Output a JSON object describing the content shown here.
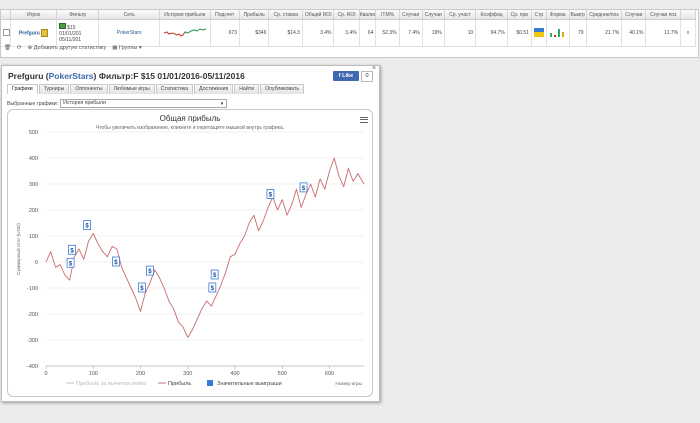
{
  "table": {
    "headers": [
      "",
      "Игрок",
      "Фильтр",
      "Сеть",
      "История прибыли",
      "Подсчет",
      "Прибыль",
      "Ср. ставка",
      "Общий ROI",
      "Ср. ROI",
      "Квалиф",
      "ITM%",
      "Случаи",
      "Случаи",
      "Ср. участ",
      "Коэффиц",
      "Ср. при",
      "Стр",
      "Форма",
      "Выигр",
      "Средние/поз",
      "Случаи",
      "Случаи поз",
      ""
    ],
    "row": {
      "player": "Prefguru",
      "filter_line1": "$15",
      "filter_line2": "01/01/201",
      "filter_line3": "05/11/201",
      "network": "PokerStars",
      "count": "673",
      "profit": "$346",
      "avg_stake": "$14.3",
      "total_roi": "3.4%",
      "avg_roi": "3.4%",
      "qualif": "64",
      "itm": "52.3%",
      "cases1": "7.4%",
      "cases2": "19%",
      "avg_part": "10",
      "coef": "94.7%",
      "avg_prize": "$0.51",
      "wins": "79",
      "avg_pos": "21.7%",
      "cases3": "40.1%",
      "cases_pos": "11.7%",
      "extra": "x"
    },
    "footer_stats": "Добавить другую статистику",
    "footer_groups": "Группы"
  },
  "panel": {
    "title_player": "Prefguru",
    "title_site": "PokerStars",
    "title_filter": "Фильтр:F $15 01/01/2016-05/11/2016",
    "fb_like": "Like",
    "fb_count": "0",
    "close": "×",
    "tabs": [
      "Графики",
      "Турниры",
      "Оппоненты",
      "Любимые игры",
      "Статистика",
      "Достижения",
      "Найти",
      "Опубликовать"
    ],
    "select_label": "Выбранные графики:",
    "select_value": "История прибыли"
  },
  "chart_data": {
    "type": "line",
    "title": "Общая прибыль",
    "subtitle": "Чтобы увеличить изображение, кликните и перетащите мышкой внутрь графика.",
    "ylabel": "Суммарный итог (USD)",
    "xlabel": "Номер игры",
    "xlim": [
      0,
      673
    ],
    "ylim": [
      -400,
      500
    ],
    "xticks": [
      0,
      100,
      200,
      300,
      400,
      500,
      600
    ],
    "yticks": [
      500,
      400,
      300,
      200,
      100,
      0,
      -100,
      -200,
      -300,
      -400
    ],
    "legend": [
      "Прибыль за вычетом рейка",
      "Прибыль",
      "Значительные выигрыши"
    ],
    "legend_colors": [
      "#cccccc",
      "#d98a8a",
      "#3a7bd5"
    ],
    "series": [
      {
        "name": "Прибыль",
        "color": "#c96b6b",
        "x": [
          0,
          10,
          20,
          30,
          40,
          50,
          60,
          70,
          80,
          90,
          100,
          110,
          120,
          130,
          140,
          150,
          160,
          170,
          180,
          190,
          200,
          210,
          220,
          230,
          240,
          250,
          260,
          270,
          280,
          290,
          300,
          310,
          320,
          330,
          340,
          350,
          360,
          370,
          380,
          390,
          400,
          410,
          420,
          430,
          440,
          450,
          460,
          470,
          480,
          490,
          500,
          510,
          520,
          530,
          540,
          550,
          560,
          570,
          580,
          590,
          600,
          610,
          620,
          630,
          640,
          650,
          660,
          673
        ],
        "y": [
          0,
          40,
          -20,
          -10,
          -50,
          -70,
          20,
          50,
          10,
          80,
          110,
          70,
          40,
          20,
          60,
          50,
          -20,
          -60,
          -100,
          -140,
          -190,
          -120,
          -80,
          -30,
          -60,
          -100,
          -150,
          -180,
          -230,
          -250,
          -290,
          -260,
          -220,
          -180,
          -150,
          -170,
          -130,
          -90,
          -40,
          20,
          30,
          70,
          100,
          150,
          180,
          120,
          160,
          210,
          250,
          200,
          240,
          180,
          220,
          280,
          210,
          260,
          300,
          250,
          320,
          280,
          350,
          400,
          330,
          290,
          360,
          310,
          340,
          300
        ]
      }
    ],
    "markers": [
      {
        "x": 52,
        "y": -5,
        "label": "$"
      },
      {
        "x": 55,
        "y": 45,
        "label": "$"
      },
      {
        "x": 87,
        "y": 140,
        "label": "$"
      },
      {
        "x": 148,
        "y": 0,
        "label": "$"
      },
      {
        "x": 203,
        "y": -100,
        "label": "$"
      },
      {
        "x": 220,
        "y": -35,
        "label": "$"
      },
      {
        "x": 352,
        "y": -100,
        "label": "$"
      },
      {
        "x": 357,
        "y": -50,
        "label": "$"
      },
      {
        "x": 475,
        "y": 260,
        "label": "$"
      },
      {
        "x": 545,
        "y": 285,
        "label": "$"
      }
    ]
  }
}
